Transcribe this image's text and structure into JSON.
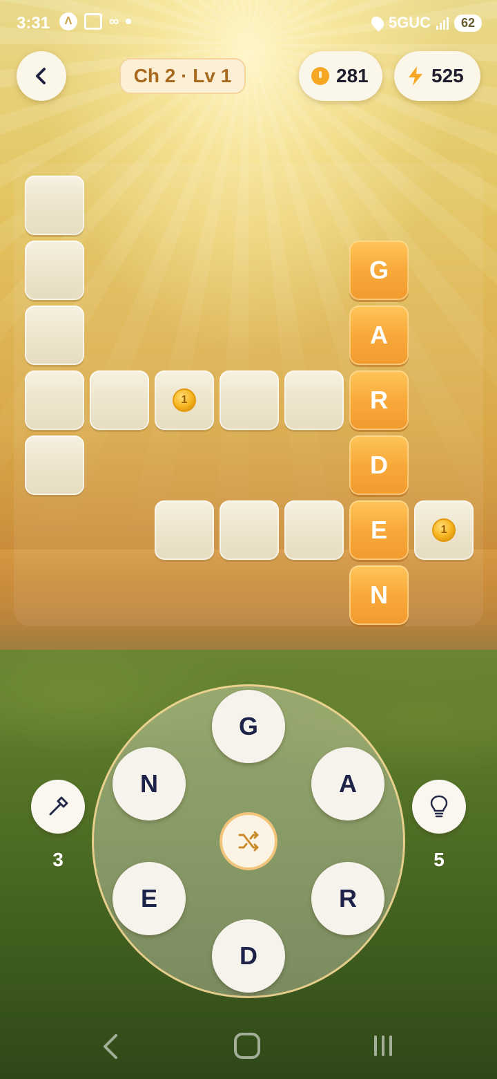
{
  "status_bar": {
    "time": "3:31",
    "network": "5GUC",
    "battery": "62"
  },
  "header": {
    "level": "Ch 2 · Lv 1",
    "coins": "281",
    "energy": "525"
  },
  "board": {
    "answer_word": "GARDEN",
    "revealed_letters": [
      "G",
      "A",
      "R",
      "D",
      "E",
      "N"
    ],
    "coin_marker": "1"
  },
  "wheel": {
    "letters": [
      "G",
      "A",
      "R",
      "D",
      "E",
      "N"
    ]
  },
  "tools": {
    "hammer_count": "3",
    "hint_count": "5"
  },
  "colors": {
    "accent": "#f8a93a",
    "tile_empty": "#efe7d0",
    "letter_text": "#1d2248"
  }
}
